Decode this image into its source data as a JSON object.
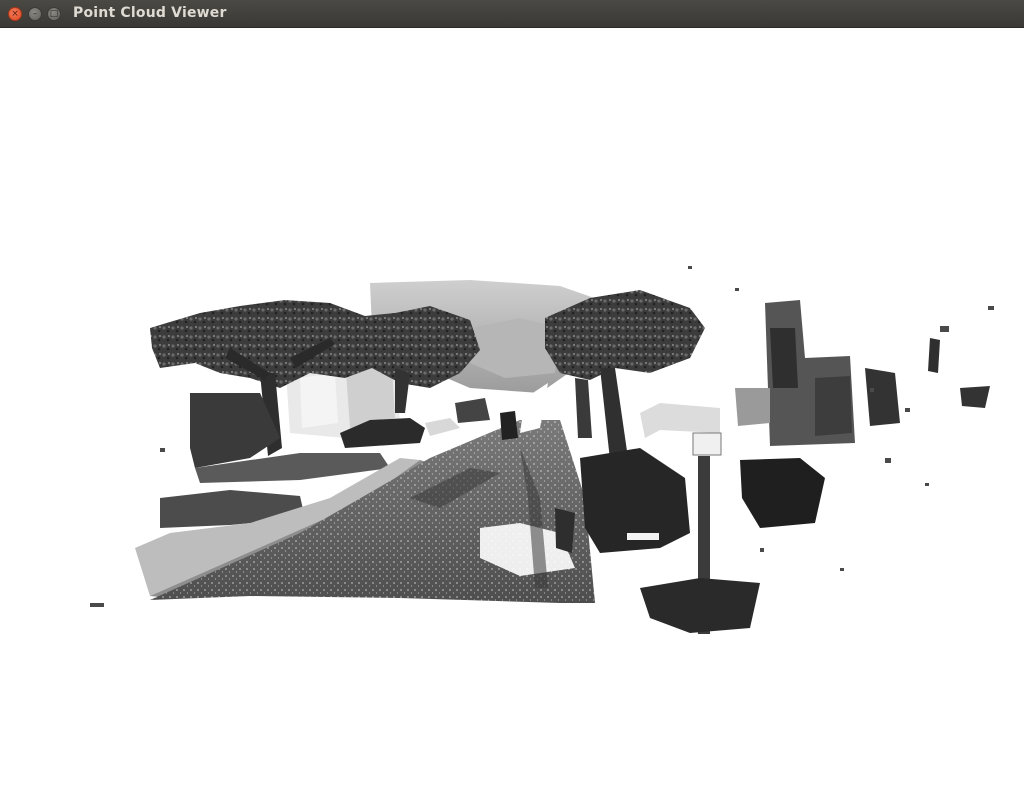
{
  "window": {
    "title": "Point Cloud Viewer",
    "controls": {
      "close_glyph": "×",
      "minimize_glyph": "–",
      "maximize_glyph": "□"
    }
  },
  "viewport": {
    "background": "#ffffff",
    "scene": "grayscale point cloud of a tree-lined street with parked cars and a signpost"
  }
}
